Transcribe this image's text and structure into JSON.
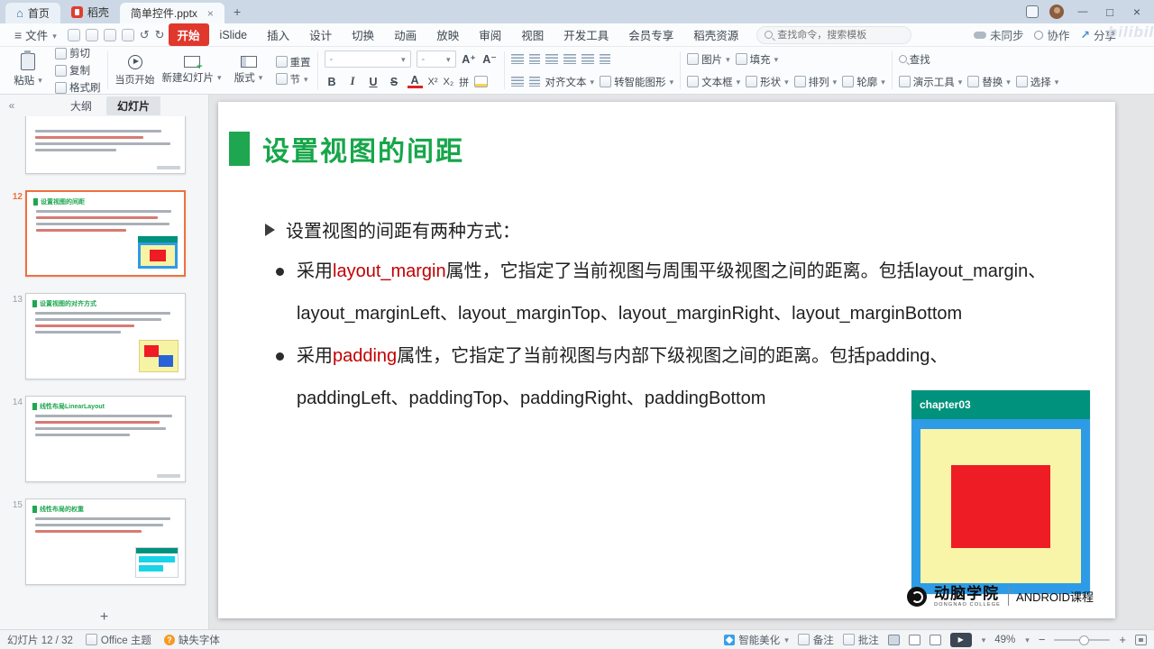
{
  "titlebar": {
    "home_tab": "首页",
    "rice_tab": "稻壳",
    "doc_tab": "简单控件.pptx"
  },
  "menubar": {
    "file": "文件",
    "tabs": [
      "开始",
      "iSlide",
      "插入",
      "设计",
      "切换",
      "动画",
      "放映",
      "审阅",
      "视图",
      "开发工具",
      "会员专享",
      "稻壳资源"
    ],
    "search_placeholder": "查找命令，搜索模板",
    "sync": "未同步",
    "collab": "协作",
    "share": "分享"
  },
  "toolbar": {
    "paste": "粘贴",
    "cut": "剪切",
    "copy": "复制",
    "format_painter": "格式刷",
    "start_from_page": "当页开始",
    "new_slide": "新建幻灯片",
    "layout": "版式",
    "reset": "重置",
    "section": "节",
    "font_name": "-",
    "font_size": "-",
    "bold": "B",
    "italic": "I",
    "underline": "U",
    "strike": "S",
    "font_color": "A",
    "sup": "X²",
    "sub": "X₂",
    "pinyin": "拼",
    "align_text": "对齐文本",
    "to_smartart": "转智能图形",
    "picture": "图片",
    "fill": "填充",
    "textbox": "文本框",
    "shapes": "形状",
    "arrange": "排列",
    "outline": "轮廓",
    "find": "查找",
    "present_tools": "演示工具",
    "replace": "替换",
    "select": "选择"
  },
  "sidebar": {
    "tab_outline": "大纲",
    "tab_slides": "幻灯片",
    "slides": [
      {
        "num": "12",
        "title": "设置视图的间距"
      },
      {
        "num": "13",
        "title": "设置视图的对齐方式"
      },
      {
        "num": "14",
        "title": "线性布局LinearLayout"
      },
      {
        "num": "15",
        "title": "线性布局的权重"
      }
    ]
  },
  "slide": {
    "title": "设置视图的间距",
    "intro": "设置视图的间距有两种方式：",
    "item1_pre": "采用",
    "item1_red": "layout_margin",
    "item1_rest": "属性，它指定了当前视图与周围平级视图之间的距离。包括layout_margin、layout_marginLeft、layout_marginTop、layout_marginRight、layout_marginBottom",
    "item2_pre": "采用",
    "item2_red": "padding",
    "item2_rest": "属性，它指定了当前视图与内部下级视图之间的距离。包括padding、paddingLeft、paddingTop、paddingRight、paddingBottom",
    "figure_caption": "chapter03",
    "logo_name": "动脑学院",
    "logo_sub": "DONGNAO COLLEGE",
    "logo_course": "ANDROID课程"
  },
  "statusbar": {
    "slide_counter": "幻灯片 12 / 32",
    "theme": "Office 主题",
    "missing_font": "缺失字体",
    "beautify": "智能美化",
    "notes": "备注",
    "comments": "批注",
    "zoom": "49%"
  },
  "watermark": "bilibili",
  "colors": {
    "accent_green": "#17a64a",
    "highlight_red": "#c00000",
    "active_tab_red": "#e0382d",
    "figure_blue": "#2e9be6",
    "figure_yellow": "#f9f5a8",
    "figure_red": "#ee1c24",
    "figure_teal": "#00927c",
    "selection_orange": "#f0703c"
  }
}
